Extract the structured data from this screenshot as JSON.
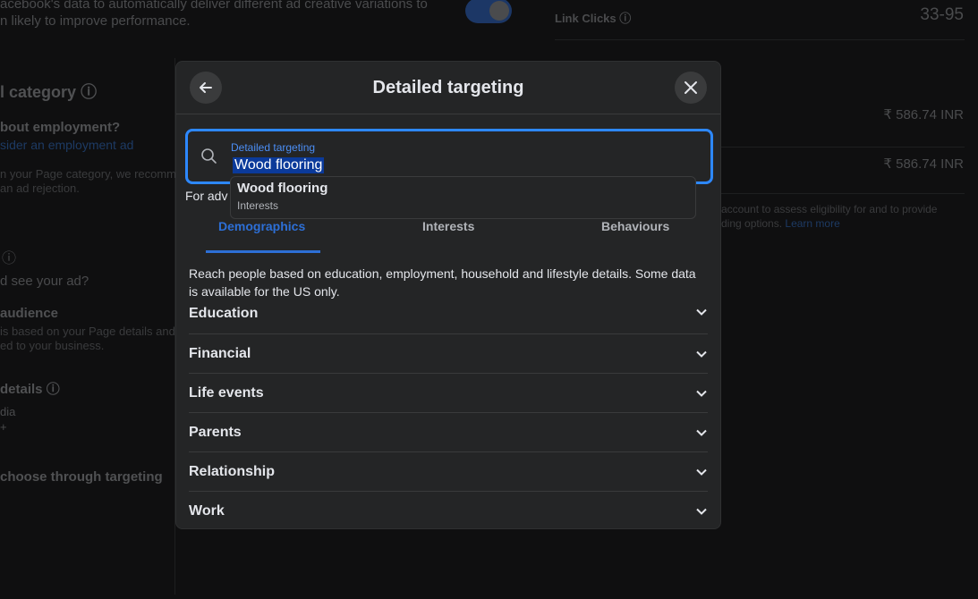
{
  "background": {
    "left": {
      "desc_line1": "acebook's data to automatically deliver different ad creative variations to",
      "desc_line2": "n likely to improve performance.",
      "category_heading": "l category",
      "employment_q": "bout employment?",
      "employment_link": "sider an employment ad",
      "page_cat_1": "n your Page category, we recomme",
      "page_cat_2": "an ad rejection.",
      "see_ad": "d see your ad?",
      "audience": "audience",
      "aud_desc1": "is based on your Page details and wil",
      "aud_desc2": "ed to your business.",
      "details": "details",
      "location": "dia",
      "age": "+",
      "choose": "choose through targeting"
    },
    "right": {
      "link_clicks_label": "Link Clicks",
      "link_clicks_value": "33-95",
      "amount1": "₹ 586.74 INR",
      "amount2": "₹ 586.74 INR",
      "note1": "account to assess eligibility for and to provide",
      "note2": "ding options.",
      "learn_more": "Learn more"
    }
  },
  "modal": {
    "title": "Detailed targeting",
    "search": {
      "label": "Detailed targeting",
      "value": "Wood flooring"
    },
    "hint": "For adv",
    "dropdown": {
      "name": "Wood flooring",
      "category": "Interests"
    },
    "tabs": [
      {
        "label": "Demographics",
        "active": true
      },
      {
        "label": "Interests"
      },
      {
        "label": "Behaviours"
      }
    ],
    "description": "Reach people based on education, employment, household and lifestyle details. Some data is available for the US only.",
    "categories": [
      "Education",
      "Financial",
      "Life events",
      "Parents",
      "Relationship",
      "Work"
    ]
  },
  "colors": {
    "accent": "#2d88ff",
    "modal_bg": "#242526"
  }
}
